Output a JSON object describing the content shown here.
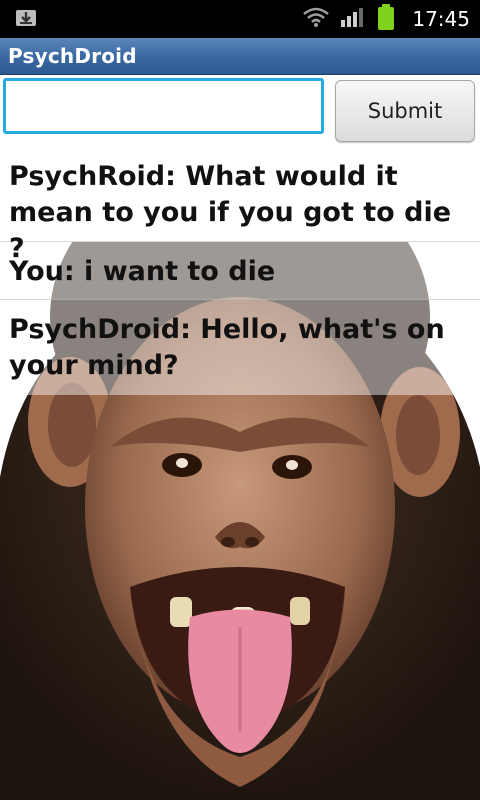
{
  "status_bar": {
    "time": "17:45",
    "icons": [
      "download-notification-icon",
      "wifi-icon",
      "signal-icon",
      "battery-icon"
    ],
    "battery_color": "#7fd11b"
  },
  "app": {
    "title": "PsychDroid",
    "accent": "#27a9e1",
    "titlebar_color": "#3b6aa3"
  },
  "input": {
    "value": "",
    "placeholder": ""
  },
  "submit_label": "Submit",
  "messages": [
    "PsychRoid: What would it mean to you if you got to die  ?",
    "You: i want to die",
    "PsychDroid: Hello, what's on your mind?"
  ],
  "background_image": "chimpanzee-photo"
}
